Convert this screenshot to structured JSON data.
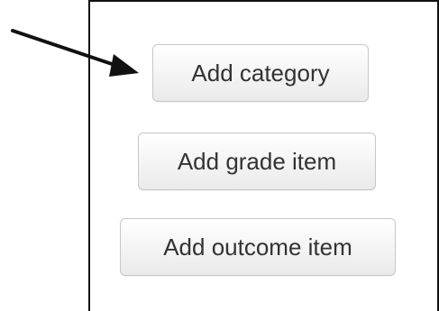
{
  "buttons": {
    "add_category": "Add category",
    "add_grade_item": "Add grade item",
    "add_outcome_item": "Add outcome item"
  },
  "annotation": {
    "arrow_icon": "arrow-pointer-icon",
    "arrow_color": "#111111"
  }
}
